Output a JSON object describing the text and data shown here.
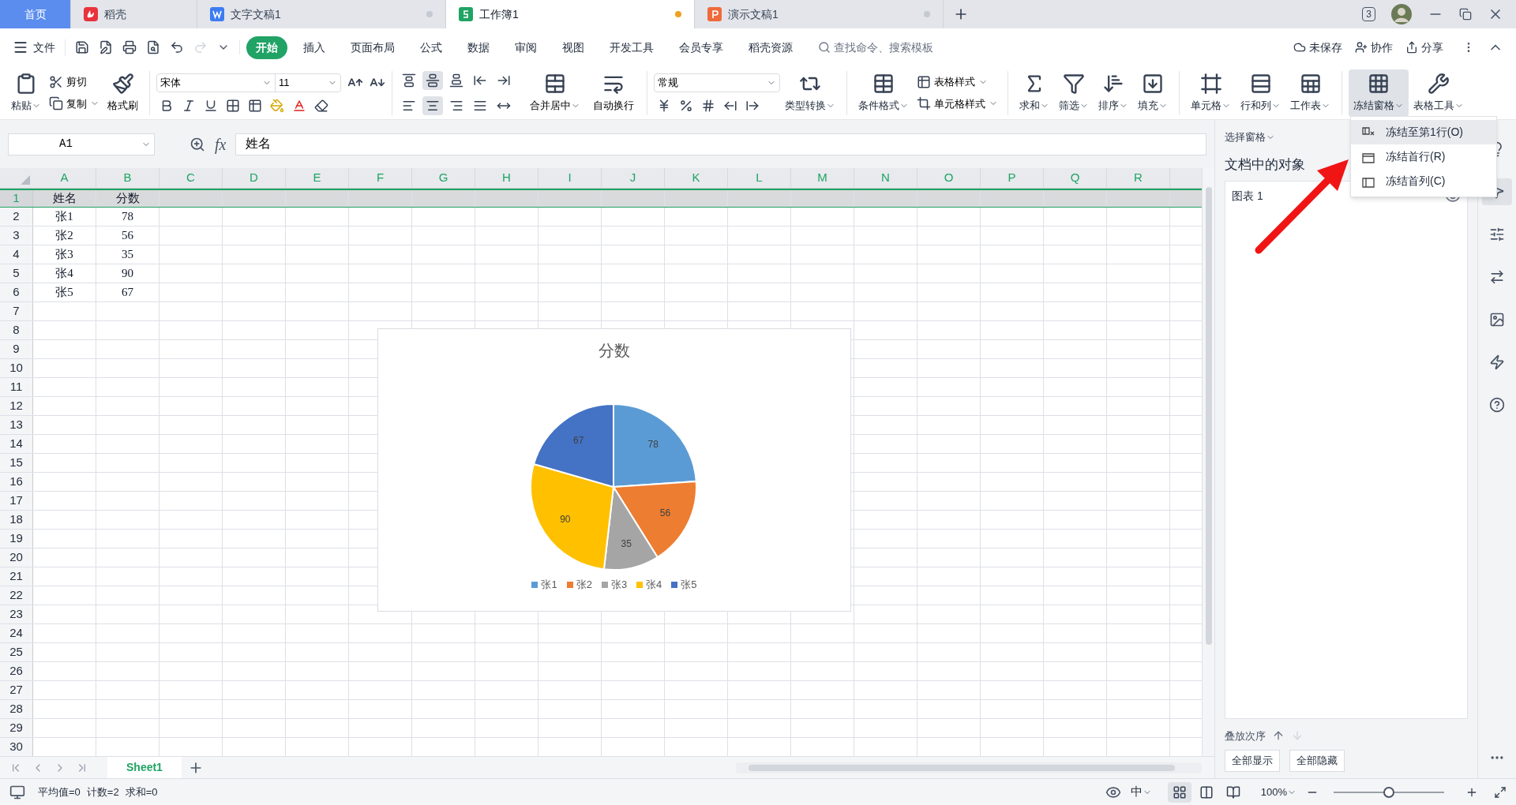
{
  "tabs": [
    {
      "label": "首页",
      "kind": "home",
      "selected": false
    },
    {
      "label": "稻壳",
      "kind": "docer",
      "selected": false
    },
    {
      "label": "文字文稿1",
      "kind": "writer",
      "selected": false
    },
    {
      "label": "工作簿1",
      "kind": "sheet",
      "selected": true
    },
    {
      "label": "演示文稿1",
      "kind": "slides",
      "selected": false
    }
  ],
  "window_count": "3",
  "menu": {
    "file": "文件",
    "items": [
      {
        "label": "开始",
        "selected": true
      },
      {
        "label": "插入",
        "selected": false
      },
      {
        "label": "页面布局",
        "selected": false
      },
      {
        "label": "公式",
        "selected": false
      },
      {
        "label": "数据",
        "selected": false
      },
      {
        "label": "审阅",
        "selected": false
      },
      {
        "label": "视图",
        "selected": false
      },
      {
        "label": "开发工具",
        "selected": false
      },
      {
        "label": "会员专享",
        "selected": false
      },
      {
        "label": "稻壳资源",
        "selected": false
      }
    ],
    "search_placeholder": "查找命令、搜索模板",
    "actions": [
      "未保存",
      "协作",
      "分享"
    ]
  },
  "ribbon": {
    "paste": "粘贴",
    "cut": "剪切",
    "copy": "复制",
    "format_painter": "格式刷",
    "font_name": "宋体",
    "font_size": "11",
    "align_buttons": [
      {
        "selected": false
      },
      {
        "selected": true
      },
      {
        "selected": false
      },
      {
        "selected": false
      },
      {
        "selected": false
      },
      {
        "selected": false
      },
      {
        "selected": true
      },
      {
        "selected": false
      },
      {
        "selected": false
      },
      {
        "selected": false
      }
    ],
    "merge": "合并居中",
    "wrap": "自动换行",
    "number_format": "常规",
    "convert": "类型转换",
    "conditional_format": "条件格式",
    "table_style": "表格样式",
    "cell_style": "单元格样式",
    "tools": [
      {
        "label": "求和",
        "selected": false
      },
      {
        "label": "筛选",
        "selected": false
      },
      {
        "label": "排序",
        "selected": false
      },
      {
        "label": "填充",
        "selected": false
      },
      {
        "label": "单元格",
        "selected": false
      },
      {
        "label": "行和列",
        "selected": false
      },
      {
        "label": "工作表",
        "selected": false
      },
      {
        "label": "冻结窗格",
        "selected": true
      },
      {
        "label": "表格工具",
        "selected": false
      }
    ]
  },
  "formula_bar": {
    "name_box": "A1",
    "fx": "fx",
    "formula": "姓名"
  },
  "sheet": {
    "columns": [
      "A",
      "B",
      "C",
      "D",
      "E",
      "F",
      "G",
      "H",
      "I",
      "J",
      "K",
      "L",
      "M",
      "N",
      "O",
      "P",
      "Q",
      "R"
    ],
    "rows": [
      {
        "number": "1",
        "selected": true,
        "cells": [
          "姓名",
          "分数"
        ]
      },
      {
        "number": "2",
        "selected": false,
        "cells": [
          "张1",
          "78"
        ]
      },
      {
        "number": "3",
        "selected": false,
        "cells": [
          "张2",
          "56"
        ]
      },
      {
        "number": "4",
        "selected": false,
        "cells": [
          "张3",
          "35"
        ]
      },
      {
        "number": "5",
        "selected": false,
        "cells": [
          "张4",
          "90"
        ]
      },
      {
        "number": "6",
        "selected": false,
        "cells": [
          "张5",
          "67"
        ]
      },
      {
        "number": "7",
        "selected": false
      },
      {
        "number": "8",
        "selected": false
      },
      {
        "number": "9",
        "selected": false
      },
      {
        "number": "10",
        "selected": false
      },
      {
        "number": "11",
        "selected": false
      },
      {
        "number": "12",
        "selected": false
      },
      {
        "number": "13",
        "selected": false
      },
      {
        "number": "14",
        "selected": false
      },
      {
        "number": "15",
        "selected": false
      },
      {
        "number": "16",
        "selected": false
      },
      {
        "number": "17",
        "selected": false
      },
      {
        "number": "18",
        "selected": false
      },
      {
        "number": "19",
        "selected": false
      },
      {
        "number": "20",
        "selected": false
      },
      {
        "number": "21",
        "selected": false
      },
      {
        "number": "22",
        "selected": false
      },
      {
        "number": "23",
        "selected": false
      },
      {
        "number": "24",
        "selected": false
      },
      {
        "number": "25",
        "selected": false
      },
      {
        "number": "26",
        "selected": false
      },
      {
        "number": "27",
        "selected": false
      },
      {
        "number": "28",
        "selected": false
      },
      {
        "number": "29",
        "selected": false
      },
      {
        "number": "30",
        "selected": false
      }
    ]
  },
  "chart": {
    "chart_data": {
      "type": "pie",
      "title": "分数",
      "categories": [
        "张1",
        "张2",
        "张3",
        "张4",
        "张5"
      ],
      "series": [
        {
          "values": [
            78,
            56,
            35,
            90,
            67
          ]
        }
      ],
      "data_labels": true,
      "legend": "bottom"
    }
  },
  "freeze_menu": {
    "items": [
      {
        "label": "冻结至第1行(O)",
        "selected": true
      },
      {
        "label": "冻结首行(R)",
        "selected": false
      },
      {
        "label": "冻结首列(C)",
        "selected": false
      }
    ]
  },
  "selection_pane": {
    "title": "选择窗格",
    "heading": "文档中的对象",
    "objects": [
      {
        "label": "图表 1"
      }
    ],
    "order_label": "叠放次序",
    "buttons": [
      "全部显示",
      "全部隐藏"
    ]
  },
  "side_tools": [
    {
      "selected": false
    },
    {
      "selected": true
    },
    {
      "selected": false
    },
    {
      "selected": false
    },
    {
      "selected": false
    },
    {
      "selected": false
    },
    {
      "selected": false
    }
  ],
  "sheet_tabs": [
    {
      "label": "Sheet1",
      "selected": true
    }
  ],
  "status_bar": {
    "stats": [
      "平均值=0",
      "计数=2",
      "求和=0"
    ],
    "input_mode": "中",
    "view_modes": [
      {
        "selected": true
      },
      {
        "selected": false
      },
      {
        "selected": false
      }
    ],
    "zoom": "100%",
    "zoom_slider": {
      "level": 0.5
    }
  }
}
